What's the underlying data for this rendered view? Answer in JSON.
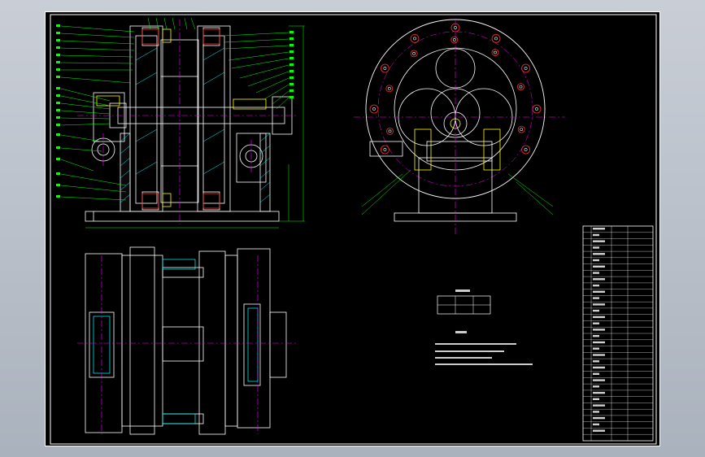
{
  "app": {
    "title": "",
    "colors": {
      "background": "#000000",
      "border": "#ffffff",
      "outline": "#ffffff",
      "centerline": "#ff00ff",
      "leader": "#00ff00",
      "hatch": "#00ffff",
      "hole": "#ff0000",
      "detail": "#ffff00"
    }
  },
  "drawing": {
    "views": [
      "front-section-view",
      "side-view",
      "plan-view"
    ],
    "title_block_rows": 34
  }
}
